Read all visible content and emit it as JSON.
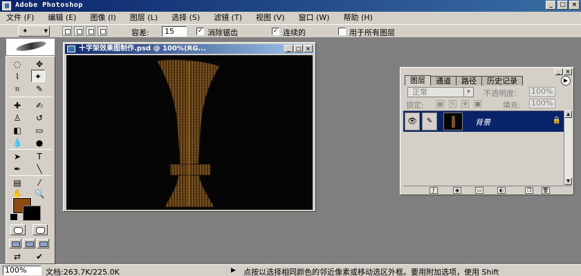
{
  "app": {
    "title": "Adobe Photoshop",
    "window_buttons": [
      "_",
      "□",
      "×"
    ]
  },
  "menu": {
    "items": [
      "文件 (F)",
      "编辑 (E)",
      "图像 (I)",
      "图层 (L)",
      "选择 (S)",
      "滤镜 (T)",
      "视图 (V)",
      "窗口 (W)",
      "帮助 (H)"
    ]
  },
  "options": {
    "tolerance_label": "容差:",
    "tolerance_value": "15",
    "antialias_label": "消除锯齿",
    "antialias_checked": "✓",
    "contiguous_label": "连续的",
    "contiguous_checked": "✓",
    "all_layers_label": "用于所有图层",
    "all_layers_checked": ""
  },
  "tools": {
    "foreground_color": "#8a4a10",
    "background_color": "#000000"
  },
  "document": {
    "title": "十字架效果图制作.psd @ 100%(RG...",
    "canvas_color": "#050505",
    "shape_color": "#6b4618"
  },
  "layers_panel": {
    "tabs": [
      "图层",
      "通道",
      "路径",
      "历史记录"
    ],
    "blend_mode": "正常",
    "opacity_label": "不透明度:",
    "opacity_value": "100%",
    "lock_label": "锁定:",
    "fill_label": "填充:",
    "fill_value": "100%",
    "layer": {
      "name": "背景",
      "eye": "👁",
      "brush": "✎",
      "lock": "🔒"
    }
  },
  "status": {
    "zoom": "100%",
    "doc_size": "文档:263.7K/225.0K",
    "arrow": "▶",
    "hint": "点按以选择相同颜色的邻近像素或移动选区外框。要用附加选项，使用 Shift"
  }
}
